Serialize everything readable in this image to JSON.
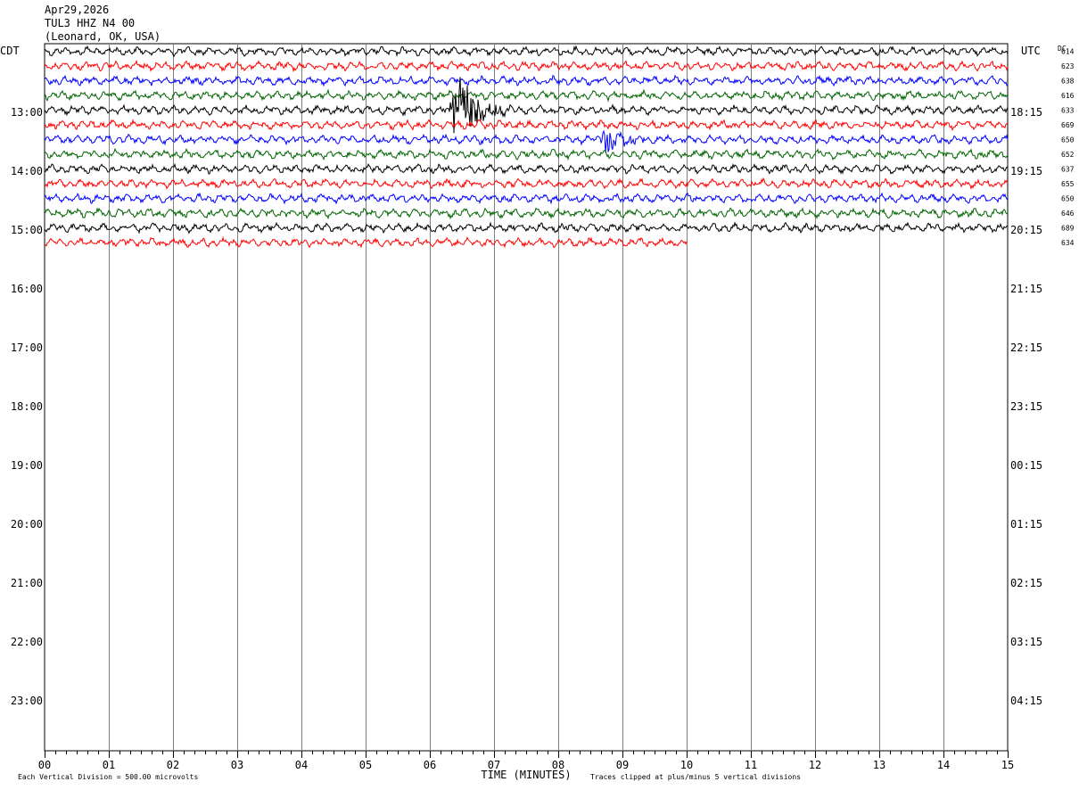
{
  "header": {
    "date": "Apr29,2026",
    "station": "TUL3 HHZ N4 00",
    "location": "(Leonard, OK, USA)"
  },
  "left_tz": "CDT",
  "right_tz": "UTC",
  "dc_label": "DC",
  "footer": {
    "scale_note": "Each Vertical Division =  500.00 microvolts",
    "xlabel": "TIME (MINUTES)",
    "clip_note": "Traces clipped at plus/minus 5 vertical divisions"
  },
  "chart_data": {
    "type": "seismogram",
    "xlabel": "TIME (MINUTES)",
    "xlim": [
      0,
      15
    ],
    "x_ticks": [
      "00",
      "01",
      "02",
      "03",
      "04",
      "05",
      "06",
      "07",
      "08",
      "09",
      "10",
      "11",
      "12",
      "13",
      "14",
      "15"
    ],
    "left_hour_labels": [
      "13:00",
      "14:00",
      "15:00",
      "16:00",
      "17:00",
      "18:00",
      "19:00",
      "20:00",
      "21:00",
      "22:00",
      "23:00"
    ],
    "right_hour_labels": [
      "18:15",
      "19:15",
      "20:15",
      "21:15",
      "22:15",
      "23:15",
      "00:15",
      "01:15",
      "02:15",
      "03:15",
      "04:15"
    ],
    "trace_colors": [
      "#000000",
      "#ff0000",
      "#0000ff",
      "#006400"
    ],
    "traces": [
      {
        "dc": "614",
        "end_minute": 15
      },
      {
        "dc": "623",
        "end_minute": 15
      },
      {
        "dc": "638",
        "end_minute": 15
      },
      {
        "dc": "616",
        "end_minute": 15
      },
      {
        "dc": "633",
        "end_minute": 15,
        "event_minute": 6.45,
        "event_amp": 5
      },
      {
        "dc": "669",
        "end_minute": 15
      },
      {
        "dc": "650",
        "end_minute": 15,
        "event_minute": 8.75,
        "event_amp": 2.2
      },
      {
        "dc": "652",
        "end_minute": 15
      },
      {
        "dc": "637",
        "end_minute": 15
      },
      {
        "dc": "655",
        "end_minute": 15
      },
      {
        "dc": "650",
        "end_minute": 15
      },
      {
        "dc": "646",
        "end_minute": 15
      },
      {
        "dc": "689",
        "end_minute": 15
      },
      {
        "dc": "634",
        "end_minute": 10
      }
    ]
  }
}
